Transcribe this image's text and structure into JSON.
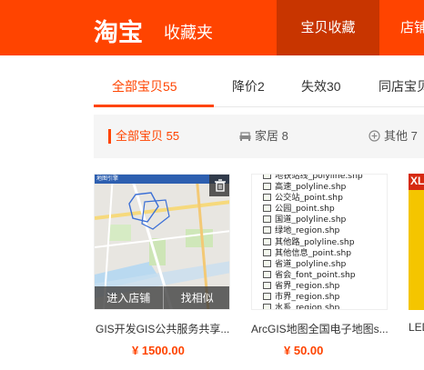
{
  "header": {
    "logo": "淘宝",
    "subtitle": "收藏夹",
    "nav": [
      "宝贝收藏",
      "店铺"
    ],
    "brand_color": "#ff4400"
  },
  "tabs": [
    {
      "label": "全部宝贝55",
      "active": true
    },
    {
      "label": "降价2",
      "active": false
    },
    {
      "label": "失效30",
      "active": false
    },
    {
      "label": "同店宝贝",
      "active": false
    }
  ],
  "filters": [
    {
      "label": "全部宝贝 55",
      "icon": "",
      "active": true
    },
    {
      "label": "家居 8",
      "icon": "sofa-icon",
      "active": false
    },
    {
      "label": "其他 7",
      "icon": "plus-circle-icon",
      "active": false
    }
  ],
  "products": [
    {
      "title": "GIS开发GIS公共服务共享...",
      "price": "¥ 1500.00",
      "actions": [
        "进入店铺",
        "找相似"
      ],
      "map_caption": "地图引擎"
    },
    {
      "title": "ArcGIS地图全国电子地图s...",
      "price": "¥ 50.00",
      "files": [
        "地铁站线_polyline.shp",
        "高速_polyline.shp",
        "公交站_point.shp",
        "公园_point.shp",
        "国道_polyline.shp",
        "绿地_region.shp",
        "其他路_polyline.shp",
        "其他信息_point.shp",
        "省道_polyline.shp",
        "省会_font_point.shp",
        "省界_region.shp",
        "市界_region.shp",
        "水系_region.shp"
      ]
    },
    {
      "title": "LED",
      "badge": "XL"
    }
  ]
}
